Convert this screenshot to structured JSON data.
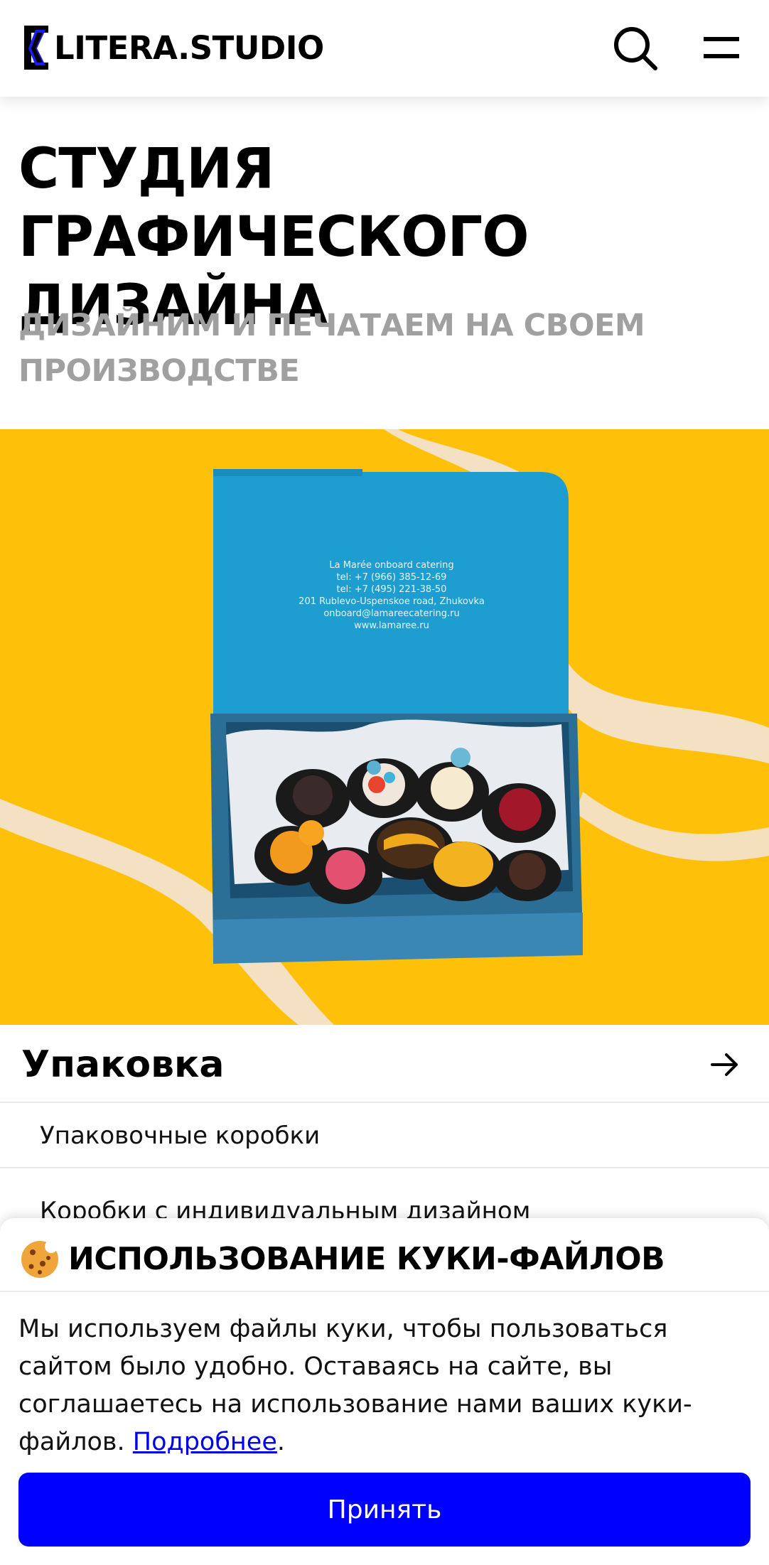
{
  "header": {
    "logo_text": "LITERA.STUDIO",
    "search_icon": "search-icon",
    "menu_icon": "hamburger-menu-icon"
  },
  "hero": {
    "title": "Студия графического дизайна",
    "subtitle": "Дизайним и печатаем на своем производстве",
    "box_print": {
      "line1": "La Marée onboard catering",
      "line2": "tel: +7 (966) 385-12-69",
      "line3": "tel: +7 (495) 221-38-50",
      "line4": "201 Rublevo-Uspenskoe road, Zhukovka",
      "line5": "onboard@lamareecatering.ru",
      "line6": "www.lamaree.ru"
    }
  },
  "category": {
    "title": "Упаковка",
    "arrow_icon": "arrow-right-icon",
    "items": [
      {
        "label": "Упаковочные коробки"
      },
      {
        "label": "Коробки с индивидуальным дизайном"
      }
    ]
  },
  "cookie": {
    "icon": "cookie-icon",
    "title": "Использование куки-файлов",
    "text": "Мы используем файлы куки, чтобы пользоваться сайтом было удобно. Оставаясь на сайте, вы соглашаетесь на использование нами ваших куки-файлов. ",
    "link_text": "Подробнее",
    "text_end": ".",
    "accept_label": "Принять"
  },
  "colors": {
    "accent": "#0000FF",
    "hero_bg": "#FFC00A",
    "box": "#1E9ED0",
    "muted_text": "#A0A0A0"
  }
}
